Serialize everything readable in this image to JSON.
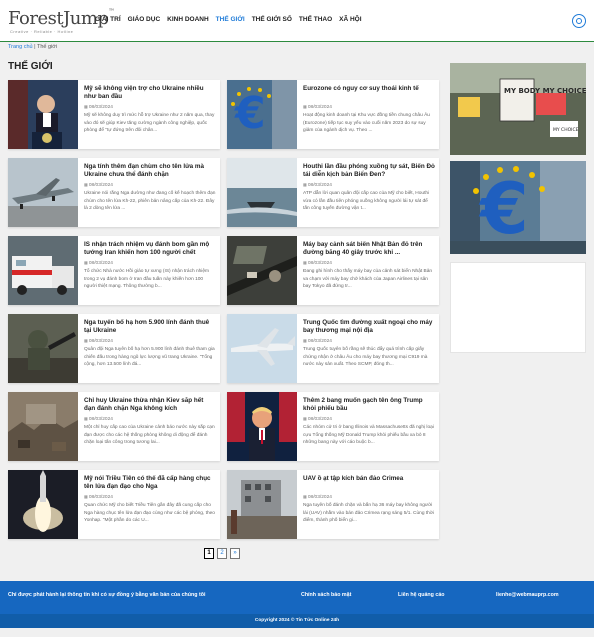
{
  "logo": {
    "name": "ForestJump",
    "tagline": "Creative · Reliable · Hotline"
  },
  "nav": [
    "GIẢI TRÍ",
    "GIÁO DỤC",
    "KINH DOANH",
    "THẾ GIỚI",
    "THẾ GIỚI SỐ",
    "THỂ THAO",
    "XÃ HỘI"
  ],
  "nav_active": "THẾ GIỚI",
  "breadcrumb": {
    "home": "Trang chủ",
    "separator": "|",
    "current": "Thế giới"
  },
  "page_title": "THẾ GIỚI",
  "articles": [
    {
      "title": "Mỹ sẽ không viện trợ cho Ukraine nhiều như ban đầu",
      "date": "08/03/2024",
      "excerpt": "Mỹ sẽ không duy trì mức hỗ trợ Ukraine như 2 năm qua, thay vào đó sẽ giúp Kiev tăng cường ngành công nghiệp, quốc phòng để \"tự đứng trên đôi chân...",
      "image": "spokesperson-podium"
    },
    {
      "title": "Eurozone có nguy cơ suy thoái kinh tế",
      "date": "08/03/2024",
      "excerpt": "Hoạt động kinh doanh tại Khu vực đồng tiền chung châu Âu (Eurozone) tiếp tục suy yếu vào cuối năm 2023 do sự suy giảm của ngành dịch vụ. Theo ...",
      "image": "euro-sculpture"
    },
    {
      "title": "Nga tính thêm đạn chùm cho tên lửa mà Ukraine chưa thể đánh chặn",
      "date": "08/03/2024",
      "excerpt": "Ukraine nói rằng Nga dường như đang cố kế hoạch thêm đạn chùm cho tên lửa Kh-22, phiên bản nâng cấp của Kh-22. Đây là 2 dòng tên lửa ...",
      "image": "bomber-aircraft"
    },
    {
      "title": "Houthi lần đầu phóng xuồng tự sát, Biển Đỏ tái diễn kịch bản Biển Đen?",
      "date": "08/03/2024",
      "excerpt": "ATP dẫn lời quan quân đội cấp cao của Mỹ cho biết, Houthi vừa có lần đầu tiên phóng xuồng không người lái tự sát để tấn công tuyến đường vận t...",
      "image": "drone-boat"
    },
    {
      "title": "IS nhận trách nhiệm vụ đánh bom gần mộ tướng Iran khiến hơn 100 người chết",
      "date": "08/03/2024",
      "excerpt": "Tổ chức Nhà nước Hồi giáo tự xưng (IS) nhận trách nhiệm trong 2 vụ đánh bom ở Iran đầu tuần này khiến hơn 100 người thiệt mạng. Thông thường b...",
      "image": "ambulance"
    },
    {
      "title": "Máy bay cảnh sát biển Nhật Bản đỗ trên đường băng 40 giây trước khi ...",
      "date": "08/03/2024",
      "excerpt": "Đang ghi hình cho thấy máy bay của cảnh sát biển Nhật Bản va chạm với máy bay chở khách của Japan Airlines tại sân bay Tokyo đã đứng tr...",
      "image": "airport-aerial"
    },
    {
      "title": "Nga tuyển bố hạ hơn 5.900 lính đánh thuê tại Ukraine",
      "date": "08/03/2024",
      "excerpt": "Quân đội Nga tuyên bố hạ hơn 5.900 lính đánh thuê tham gia chiến đấu trong hàng ngũ lực lượng vũ trang Ukraine. \"Tổng cộng, hơn 13.500 lính đá...",
      "image": "soldier"
    },
    {
      "title": "Trung Quốc tìm đường xuất ngoại cho máy bay thương mại nội địa",
      "date": "08/03/2024",
      "excerpt": "Trung Quốc tuyên bố rằng sẽ thúc đẩy quá trình cấp giấy chứng nhận ở châu Âu cho máy bay thương mại C919 mà nước này sản xuất. Theo SCMP, đóng th...",
      "image": "airliner"
    },
    {
      "title": "Chỉ huy Ukraine thừa nhận Kiev sắp hết đạn đánh chặn Nga không kích",
      "date": "08/03/2024",
      "excerpt": "Một chỉ huy cấp cao của Ukraine cảnh báo nước này sắp cạn đạn được cho các hệ thống phòng không di động để đánh chặn loại tấn công trong tương lai...",
      "image": "rubble"
    },
    {
      "title": "Thêm 2 bang muốn gạch tên ông Trump khỏi phiếu bầu",
      "date": "08/03/2024",
      "excerpt": "Các nhóm cử tri ở bang Illinois và Massachusetts đã nghị loại cựu Tổng thống Mỹ Donald Trump khỏi phiếu bầu xa bỏ 8 những bang này với cáo buộc b...",
      "image": "trump-flags"
    },
    {
      "title": "Mỹ nói Triều Tiên có thể đã cấp hàng chục tên lửa đạn đạo cho Nga",
      "date": "08/03/2024",
      "excerpt": "Quan chức Mỹ cho biết Triều Tiên gần đây đã cung cấp cho Nga hàng chục tên lửa đạn đạo cùng như các bệ phóng, theo Yonhap. \"Một phần do các U...",
      "image": "missile-launch"
    },
    {
      "title": "UAV ồ ạt tập kích bán đảo Crimea",
      "date": "08/03/2024",
      "excerpt": "Nga tuyên bố đánh chặn và bắn hạ 36 máy bay không người lái (UAV) nhằm vào bán đảo Crimea rạng sáng 5/1. Cùng thời điểm, thành phố biển gi...",
      "image": "destroyed-building"
    }
  ],
  "sidebar": [
    {
      "image": "protest-signs",
      "signs": [
        "MY BODY MY CHOICE",
        "MY CHOICE"
      ]
    },
    {
      "image": "euro-sculpture-large"
    },
    {
      "image": "blank"
    }
  ],
  "pagination": {
    "pages": [
      "1",
      "2",
      "»"
    ],
    "active": "1"
  },
  "footer": {
    "license": "Chỉ được phát hành lại thông tin khi có sự đồng ý bằng văn bản của chúng tôi",
    "privacy": "Chính sách bảo mật",
    "ads": "Liên hệ quảng cáo",
    "email": "lienhe@webmauprp.com",
    "copyright": "Copyright 2024 © Tin Tức Online 24h"
  },
  "colors": {
    "accent": "#1f7bd8",
    "footer": "#1667c0",
    "header_line": "#2d8a3e"
  }
}
